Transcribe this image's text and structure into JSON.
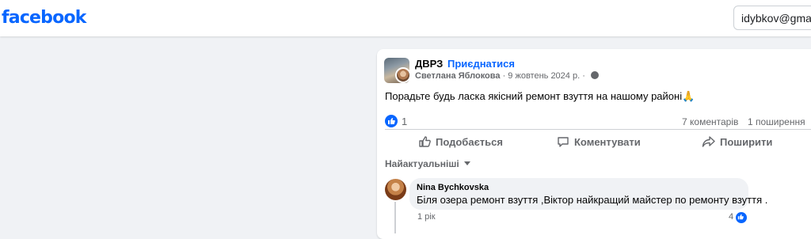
{
  "header": {
    "logo_text": "facebook",
    "login_value": "idybkov@gmail."
  },
  "post": {
    "group_name": "ДВРЗ",
    "separator": "·",
    "join_label": "Приєднатися",
    "author": "Светлана Яблокова",
    "date": "· 9 жовтень 2024 р. ·",
    "text": "Порадьте будь ласка якісний ремонт взуття на нашому районі🙏",
    "like_count": "1",
    "comments_count": "7 коментарів",
    "shares_count": "1 поширення"
  },
  "actions": {
    "like_label": "Подобається",
    "comment_label": "Коментувати",
    "share_label": "Поширити"
  },
  "comments": {
    "sort_label": "Найактуальніші",
    "items": [
      {
        "author": "Nina Bychkovska",
        "text": "Біля озера ремонт взуття ,Віктор найкращий майстер по ремонту взуття .",
        "time": "1 рік",
        "reactions": "4"
      }
    ]
  },
  "colors": {
    "brand": "#0866ff",
    "secondary_text": "#65676b",
    "background": "#f0f2f5"
  }
}
